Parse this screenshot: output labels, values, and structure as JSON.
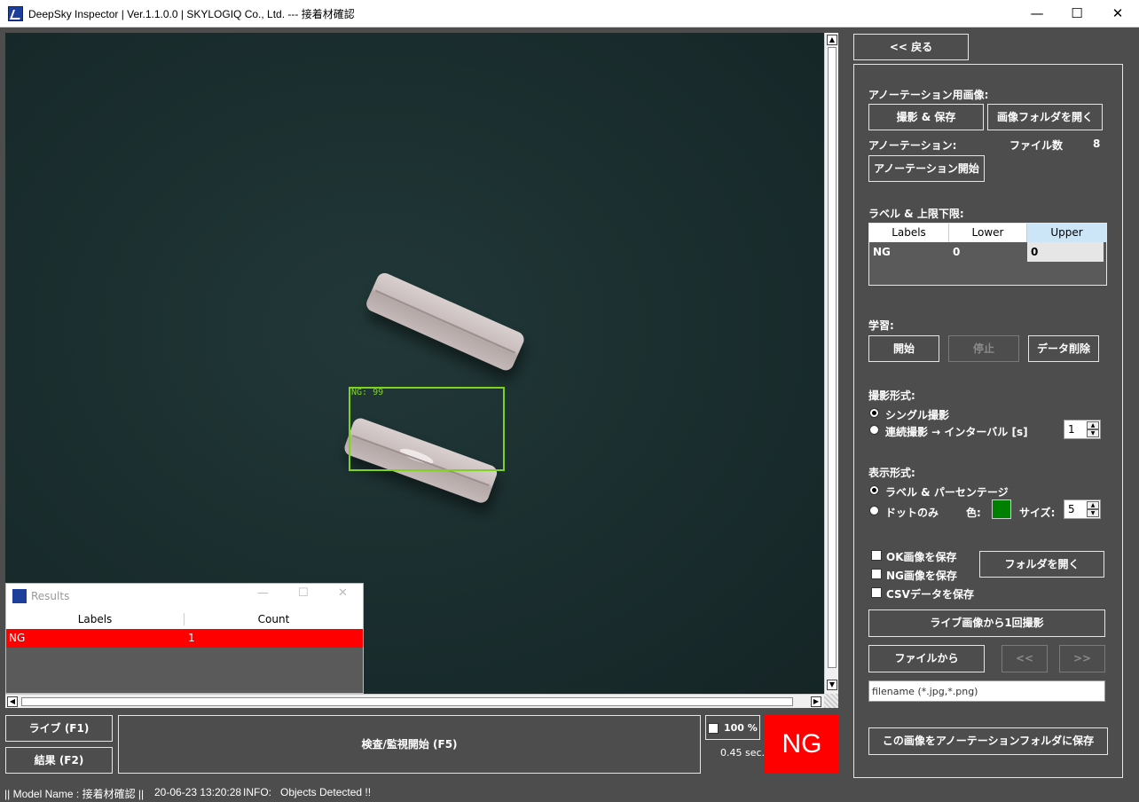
{
  "window": {
    "title": "DeepSky Inspector | Ver.1.1.0.0 | SKYLOGIQ Co., Ltd. --- 接着材確認",
    "minimize": "—",
    "maximize": "☐",
    "close": "✕"
  },
  "viewport": {
    "detection_label": "NG: 99",
    "detection_color": "#7ed321"
  },
  "results": {
    "title": "Results",
    "columns": [
      "Labels",
      "Count"
    ],
    "rows": [
      {
        "label": "NG",
        "count": "1"
      }
    ],
    "row_color": "#ff0000"
  },
  "controls": {
    "live_button": "ライブ (F1)",
    "result_button": "結果 (F2)",
    "inspect_button": "検査/監視開始 (F5)",
    "zoom_label": "100 %",
    "timing": "0.45 sec.",
    "verdict": "NG",
    "verdict_color": "#ff0000"
  },
  "status_bar": {
    "model": "|| Model Name : 接着材確認 ||",
    "datetime": "20-06-23 13:20:28",
    "info": "INFO:   Objects Detected !!"
  },
  "right_panel": {
    "back_button": "<< 戻る",
    "annotation_images_label": "アノーテーション用画像:",
    "capture_save_button": "撮影 & 保存",
    "open_image_folder_button": "画像フォルダを開く",
    "annotation_label": "アノーテーション:",
    "file_count_label": "ファイル数",
    "file_count_value": "8",
    "start_annotation_button": "アノーテーション開始",
    "label_limits_label": "ラベル & 上限下限:",
    "limits_table": {
      "headers": [
        "Labels",
        "Lower",
        "Upper"
      ],
      "rows": [
        {
          "label": "NG",
          "lower": "0",
          "upper": "0"
        }
      ]
    },
    "learning_label": "学習:",
    "start_button": "開始",
    "stop_button": "停止",
    "delete_data_button": "データ削除",
    "capture_mode_label": "撮影形式:",
    "single_capture": "シングル撮影",
    "continuous_capture": "連続撮影 → インターバル [s]",
    "interval_value": "1",
    "display_mode_label": "表示形式:",
    "label_percentage": "ラベル & パーセンテージ",
    "dots_only": "ドットのみ",
    "color_label": "色:",
    "color_value": "#008000",
    "size_label": "サイズ:",
    "size_value": "5",
    "save_ok_images": "OK画像を保存",
    "save_ng_images": "NG画像を保存",
    "save_csv": "CSVデータを保存",
    "open_folder_button": "フォルダを開く",
    "capture_from_live_button": "ライブ画像から1回撮影",
    "from_file_button": "ファイルから",
    "prev_button": "<<",
    "next_button": ">>",
    "filename_placeholder": "filename (*.jpg,*.png)",
    "save_to_annotation_button": "この画像をアノーテーションフォルダに保存"
  }
}
